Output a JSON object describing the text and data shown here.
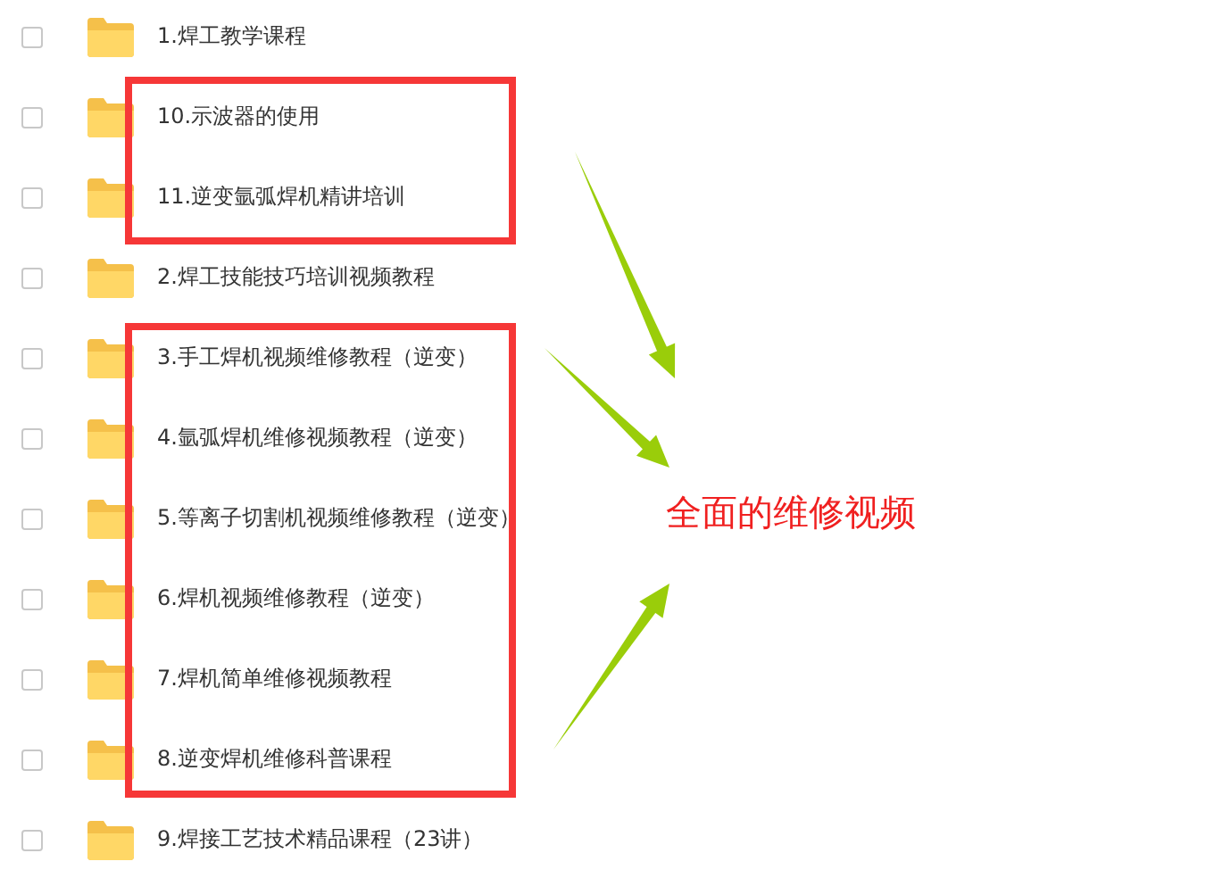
{
  "files": [
    {
      "name": "1.焊工教学课程",
      "checked": false
    },
    {
      "name": "10.示波器的使用",
      "checked": false
    },
    {
      "name": "11.逆变氩弧焊机精讲培训",
      "checked": false
    },
    {
      "name": "2.焊工技能技巧培训视频教程",
      "checked": false
    },
    {
      "name": "3.手工焊机视频维修教程（逆变）",
      "checked": false
    },
    {
      "name": "4.氩弧焊机维修视频教程（逆变）",
      "checked": false
    },
    {
      "name": "5.等离子切割机视频维修教程（逆变）",
      "checked": false
    },
    {
      "name": "6.焊机视频维修教程（逆变）",
      "checked": false
    },
    {
      "name": "7.焊机简单维修视频教程",
      "checked": false
    },
    {
      "name": "8.逆变焊机维修科普课程",
      "checked": false
    },
    {
      "name": "9.焊接工艺技术精品课程（23讲）",
      "checked": false
    }
  ],
  "annotation": {
    "text": "全面的维修视频"
  }
}
